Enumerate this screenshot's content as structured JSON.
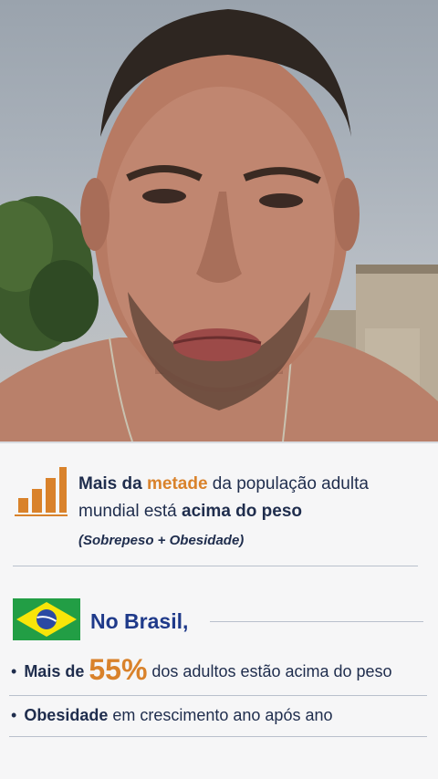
{
  "video": {
    "description_icons": [
      "person-face",
      "tree",
      "building"
    ]
  },
  "card": {
    "headline": {
      "part1": "Mais da ",
      "accent": "metade",
      "part2": " da população adulta",
      "line2_part1": "mundial está ",
      "line2_strong": "acima do peso",
      "note": "(Sobrepeso + Obesidade)"
    },
    "country_label": "No Brasil,",
    "bullets": [
      {
        "lead": "Mais de ",
        "big": "55%",
        "rest": " dos adultos estão acima do peso"
      },
      {
        "lead": "Obesidade",
        "rest": " em crescimento ano após ano"
      }
    ],
    "colors": {
      "accent": "#d9822b",
      "navy": "#1f2d4d",
      "blue": "#1f3a8a",
      "flag_green": "#229e45",
      "flag_yellow": "#f8e509"
    }
  }
}
